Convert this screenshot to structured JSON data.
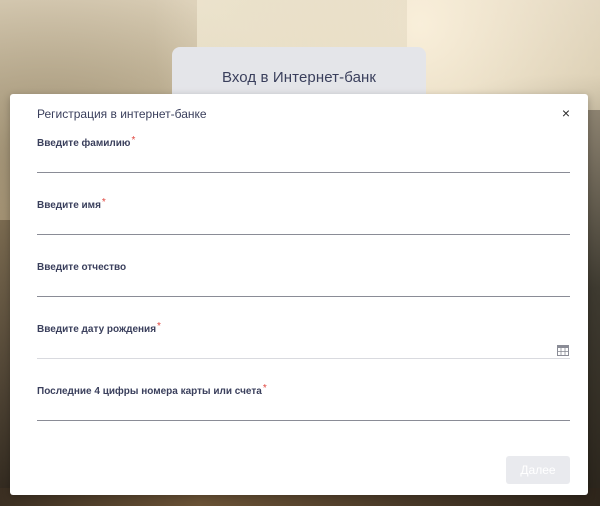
{
  "login": {
    "title": "Вход в Интернет-банк"
  },
  "modal": {
    "title": "Регистрация в интернет-банке",
    "close_label": "×",
    "fields": [
      {
        "label": "Введите фамилию",
        "required": "*",
        "value": ""
      },
      {
        "label": "Введите имя",
        "required": "*",
        "value": ""
      },
      {
        "label": "Введите отчество",
        "required": "",
        "value": ""
      },
      {
        "label": "Введите дату рождения",
        "required": "*",
        "value": "",
        "icon": "calendar-icon"
      },
      {
        "label": "Последние 4 цифры номера карты или счета",
        "required": "*",
        "value": ""
      }
    ],
    "next_label": "Далее"
  },
  "colors": {
    "text": "#3a3f5c",
    "required": "#e0453e",
    "button_disabled": "#e9eaee"
  }
}
